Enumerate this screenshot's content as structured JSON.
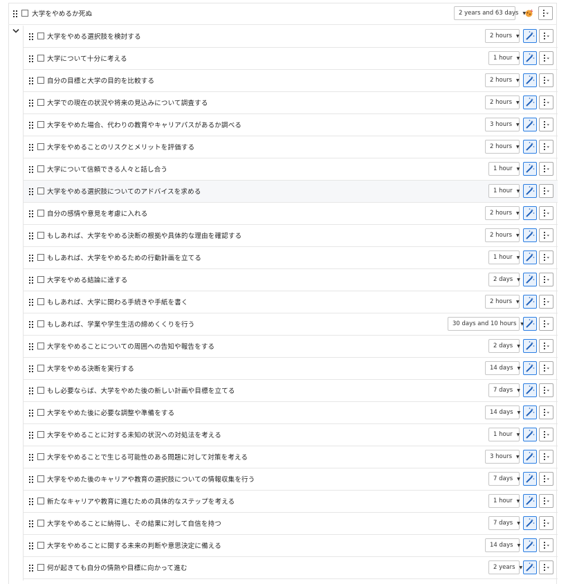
{
  "root_task": {
    "label": "大学をやめるか死ぬ",
    "duration": "2 years and 63 days"
  },
  "subtasks": [
    {
      "label": "大学をやめる選択肢を検討する",
      "duration": "2 hours"
    },
    {
      "label": "大学について十分に考える",
      "duration": "1 hour"
    },
    {
      "label": "自分の目標と大学の目的を比較する",
      "duration": "2 hours"
    },
    {
      "label": "大学での現在の状況や将来の見込みについて調査する",
      "duration": "2 hours"
    },
    {
      "label": "大学をやめた場合、代わりの教育やキャリアパスがあるか調べる",
      "duration": "3 hours"
    },
    {
      "label": "大学をやめることのリスクとメリットを評価する",
      "duration": "2 hours"
    },
    {
      "label": "大学について信頼できる人々と話し合う",
      "duration": "1 hour"
    },
    {
      "label": "大学をやめる選択肢についてのアドバイスを求める",
      "duration": "1 hour"
    },
    {
      "label": "自分の感情や意見を考慮に入れる",
      "duration": "2 hours"
    },
    {
      "label": "もしあれば、大学をやめる決断の根拠や具体的な理由を確認する",
      "duration": "2 hours"
    },
    {
      "label": "もしあれば、大学をやめるための行動計画を立てる",
      "duration": "1 hour"
    },
    {
      "label": "大学をやめる結論に達する",
      "duration": "2 days"
    },
    {
      "label": "もしあれば、大学に関わる手続きや手紙を書く",
      "duration": "2 hours"
    },
    {
      "label": "もしあれば、学業や学生生活の締めくくりを行う",
      "duration": "30 days and 10 hours"
    },
    {
      "label": "大学をやめることについての周囲への告知や報告をする",
      "duration": "2 days"
    },
    {
      "label": "大学をやめる決断を実行する",
      "duration": "14 days"
    },
    {
      "label": "もし必要ならば、大学をやめた後の新しい計画や目標を立てる",
      "duration": "7 days"
    },
    {
      "label": "大学をやめた後に必要な調整や準備をする",
      "duration": "14 days"
    },
    {
      "label": "大学をやめることに対する未知の状況への対処法を考える",
      "duration": "1 hour"
    },
    {
      "label": "大学をやめることで生じる可能性のある問題に対して対策を考える",
      "duration": "3 hours"
    },
    {
      "label": "大学をやめた後のキャリアや教育の選択肢についての情報収集を行う",
      "duration": "7 days"
    },
    {
      "label": "新たなキャリアや教育に進むための具体的なステップを考える",
      "duration": "1 hour"
    },
    {
      "label": "大学をやめることに納得し、その結果に対して自信を持つ",
      "duration": "7 days"
    },
    {
      "label": "大学をやめることに関する未来の判断や意思決定に備える",
      "duration": "14 days"
    },
    {
      "label": "何が起きても自分の情熱や目標に向かって進む",
      "duration": "2 years"
    }
  ],
  "icons": {
    "drag": "drag-handle-icon",
    "checkbox": "checkbox-icon",
    "dropdown": "caret-down-icon",
    "magic": "magic-wand-icon",
    "menu": "vertical-menu-icon",
    "collapse": "chevron-down-icon",
    "emoji": "sparkle-emoji-icon"
  },
  "colors": {
    "accent": "#2a7de1",
    "border": "#c6c6c6"
  }
}
